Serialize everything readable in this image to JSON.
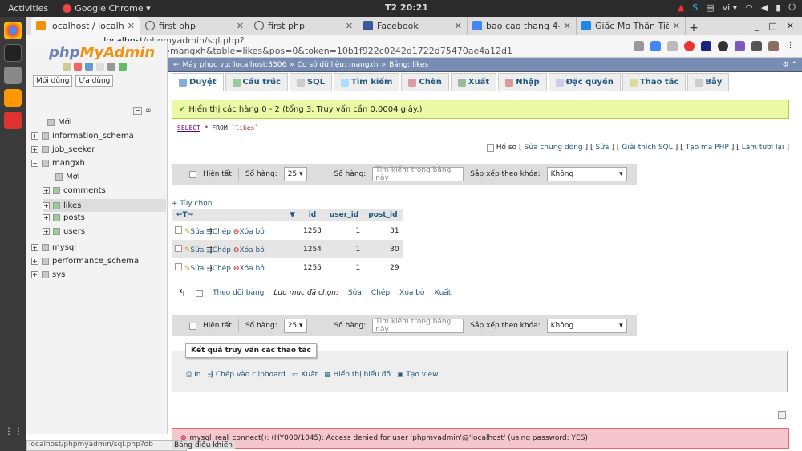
{
  "topbar": {
    "activities": "Activities",
    "app_name": "Google Chrome ▾",
    "clock": "T2 20:21",
    "lang": "vi ▾"
  },
  "browser": {
    "tabs": [
      {
        "label": "localhost / localho",
        "active": true
      },
      {
        "label": "first php"
      },
      {
        "label": "first php"
      },
      {
        "label": "Facebook"
      },
      {
        "label": "bao cao thang 4-5"
      },
      {
        "label": "Giấc Mơ Thần Tiê"
      }
    ],
    "url_host": "localhost",
    "url_path": "/phpmyadmin/sql.php?server=1&db=mangxh&table=likes&pos=0&token=10b1f922c0242d1722d75470ae4a12d1"
  },
  "sidebar": {
    "logo_php": "php",
    "logo_myadmin": "MyAdmin",
    "recent": "Mới dùng",
    "favorites": "Ưa dùng",
    "tree": [
      {
        "label": "Mới",
        "level": 0
      },
      {
        "label": "information_schema",
        "level": 0
      },
      {
        "label": "job_seeker",
        "level": 0
      },
      {
        "label": "mangxh",
        "level": 0
      },
      {
        "label": "Mới",
        "level": 1
      },
      {
        "label": "comments",
        "level": 1
      },
      {
        "label": "likes",
        "level": 1,
        "selected": true
      },
      {
        "label": "posts",
        "level": 1
      },
      {
        "label": "users",
        "level": 1
      },
      {
        "label": "mysql",
        "level": 0
      },
      {
        "label": "performance_schema",
        "level": 0
      },
      {
        "label": "sys",
        "level": 0
      }
    ]
  },
  "breadcrumb": {
    "server": "Máy phục vụ: localhost:3306",
    "db": "Cơ sở dữ liệu: mangxh",
    "table": "Bảng: likes"
  },
  "main_tabs": [
    "Duyệt",
    "Cấu trúc",
    "SQL",
    "Tìm kiếm",
    "Chèn",
    "Xuất",
    "Nhập",
    "Đặc quyền",
    "Thao tác",
    "Bẫy"
  ],
  "success": "Hiển thị các hàng 0 - 2 (tổng 3, Truy vấn cần 0.0004 giây.)",
  "sql": {
    "kw": "SELECT",
    "rest": "* FROM",
    "table": "`likes`"
  },
  "profiling": {
    "label": "Hồ sơ",
    "links": [
      "Sửa chung dòng",
      "Sửa",
      "Giải thích SQL",
      "Tạo mã PHP",
      "Làm tươi lại"
    ]
  },
  "navbar": {
    "show_all": "Hiện tất",
    "rows_label": "Số hàng:",
    "rows_value": "25 ▾",
    "filter_label": "Số hàng:",
    "filter_placeholder": "Tìm kiếm trong bảng này",
    "sort_label": "Sắp xếp theo khóa:",
    "sort_value": "Không"
  },
  "options": "+ Tùy chọn",
  "columns": [
    "id",
    "user_id",
    "post_id"
  ],
  "rows": [
    {
      "id": "1253",
      "user_id": "1",
      "post_id": "31"
    },
    {
      "id": "1254",
      "user_id": "1",
      "post_id": "30"
    },
    {
      "id": "1255",
      "user_id": "1",
      "post_id": "29"
    }
  ],
  "row_actions": {
    "edit": "Sửa",
    "copy": "Chép",
    "delete": "Xóa bỏ"
  },
  "with_selected": {
    "check_all": "Theo dõi bảng",
    "label": "Lưu mục đã chọn:",
    "edit": "Sửa",
    "copy": "Chép",
    "delete": "Xóa bỏ",
    "export": "Xuất"
  },
  "query_ops": {
    "title": "Kết quả truy vấn các thao tác",
    "print": "In",
    "clipboard": "Chép vào clipboard",
    "export": "Xuất",
    "chart": "Hiển thị biểu đồ",
    "view": "Tạo view"
  },
  "error": "mysql_real_connect(): (HY000/1045): Access denied for user 'phpmyadmin'@'localhost' (using password: YES)",
  "status_url": "localhost/phpmyadmin/sql.php?db",
  "console": "Bảng điều khiển"
}
